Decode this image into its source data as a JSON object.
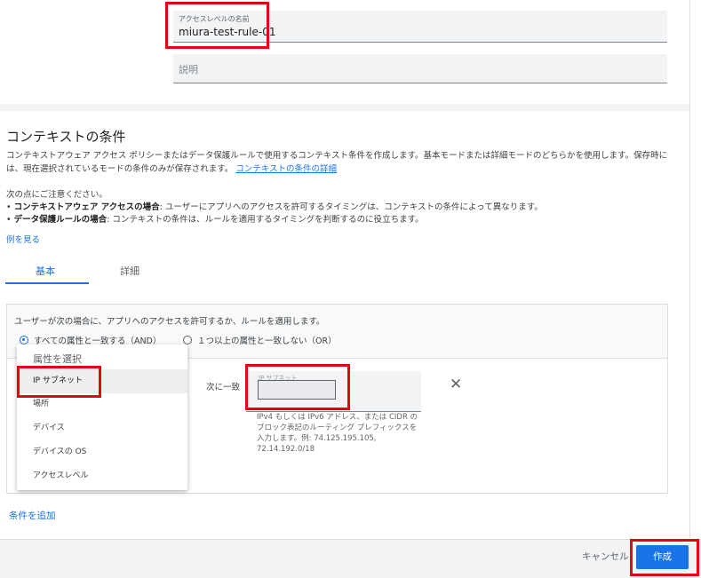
{
  "access_level": {
    "name_label": "アクセスレベルの名前",
    "name_value": "miura-test-rule-01",
    "description_placeholder": "説明"
  },
  "context": {
    "title": "コンテキストの条件",
    "description": "コンテキストアウェア アクセス ポリシーまたはデータ保護ルールで使用するコンテキスト条件を作成します。基本モードまたは詳細モードのどちらかを使用します。保存時には、現在選択されているモードの条件のみが保存されます。",
    "description_link": "コンテキストの条件の詳細",
    "note_heading": "次の点にご注意ください。",
    "bullet1_bold": "コンテキストアウェア アクセスの場合",
    "bullet1_text": ": ユーザーにアプリへのアクセスを許可するタイミングは、コンテキストの条件によって異なります。",
    "bullet2_bold": "データ保護ルールの場合",
    "bullet2_text": ": コンテキストの条件は、ルールを適用するタイミングを判断するのに役立ちます。",
    "see_example": "例を見る"
  },
  "tabs": {
    "basic": "基本",
    "detail": "詳細"
  },
  "condition": {
    "intro": "ユーザーが次の場合に、アプリへのアクセスを許可するか、ルールを適用します。",
    "radio_all": "すべての属性と一致する（AND）",
    "radio_any": "１つ以上の属性と一致しない（OR）",
    "match_label": "次に一致",
    "ip_label": "IP サブネット",
    "ip_help": "IPv4 もしくは IPv6 アドレス、または CIDR のブロック表記のルーティング プレフィックスを入力します。例: 74.125.195.105, 72.14.192.0/18"
  },
  "dropdown": {
    "label": "属性を選択",
    "items": [
      "IP サブネット",
      "場所",
      "デバイス",
      "デバイスの OS",
      "アクセスレベル"
    ]
  },
  "add_condition": "条件を追加",
  "footer": {
    "cancel": "キャンセル",
    "create": "作成"
  },
  "colors": {
    "accent": "#1a73e8",
    "highlight": "#e60012"
  }
}
